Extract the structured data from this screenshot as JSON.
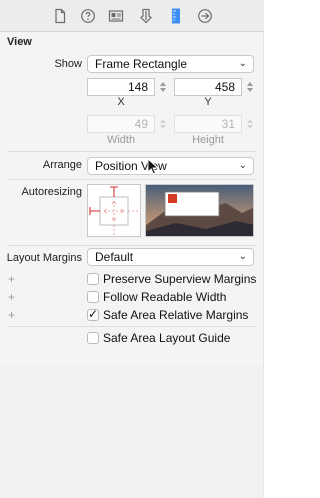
{
  "inspector_tabs": [
    {
      "name": "file-inspector",
      "icon": "file-icon"
    },
    {
      "name": "quick-help",
      "icon": "question-circle-icon"
    },
    {
      "name": "identity-inspector",
      "icon": "identity-card-icon"
    },
    {
      "name": "attributes-inspector",
      "icon": "shield-icon"
    },
    {
      "name": "size-inspector",
      "icon": "ruler-icon",
      "active": true
    },
    {
      "name": "connections-inspector",
      "icon": "arrow-circle-icon"
    }
  ],
  "view_section": {
    "title": "View",
    "show_label": "Show",
    "show_value": "Frame Rectangle",
    "x_value": "148",
    "x_caption": "X",
    "y_value": "458",
    "y_caption": "Y",
    "width_value": "49",
    "width_caption": "Width",
    "height_value": "31",
    "height_caption": "Height",
    "arrange_label": "Arrange",
    "arrange_value": "Position View",
    "autoresizing_label": "Autoresizing"
  },
  "layout_margins": {
    "label": "Layout Margins",
    "value": "Default",
    "options": [
      {
        "label": "Preserve Superview Margins",
        "checked": false
      },
      {
        "label": "Follow Readable Width",
        "checked": false
      },
      {
        "label": "Safe Area Relative Margins",
        "checked": true
      }
    ],
    "layout_guide": {
      "label": "Safe Area Layout Guide",
      "checked": false
    }
  },
  "colors": {
    "accent": "#3b8ef3",
    "strut_red": "#d9534f",
    "preview_red": "#d63a22"
  }
}
